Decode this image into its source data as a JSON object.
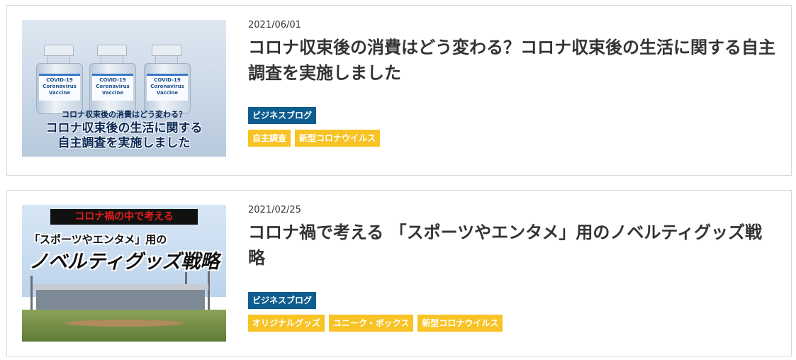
{
  "posts": [
    {
      "date": "2021/06/01",
      "title": "コロナ収束後の消費はどう変わる？コロナ収束後の生活に関する自主調査を実施しました",
      "category": "ビジネスブログ",
      "tags": [
        "自主調査",
        "新型コロナウイルス"
      ],
      "thumbnail": {
        "vial_label": "COVID-19 Coronavirus Vaccine",
        "line1": "コロナ収束後の消費はどう変わる？",
        "line2": "コロナ収束後の生活に関する",
        "line3": "自主調査を実施しました"
      }
    },
    {
      "date": "2021/02/25",
      "title": "コロナ禍で考える 「スポーツやエンタメ」用のノベルティグッズ戦略",
      "category": "ビジネスブログ",
      "tags": [
        "オリジナルグッズ",
        "ユニーク・ボックス",
        "新型コロナウイルス"
      ],
      "thumbnail": {
        "banner": "コロナ禍の中で考える",
        "line1": "「スポーツやエンタメ」用の",
        "line2": "ノベルティグッズ戦略"
      }
    }
  ],
  "colors": {
    "category_bg": "#0e5d8f",
    "tag_bg": "#f7c325",
    "border": "#d8d8d8"
  }
}
